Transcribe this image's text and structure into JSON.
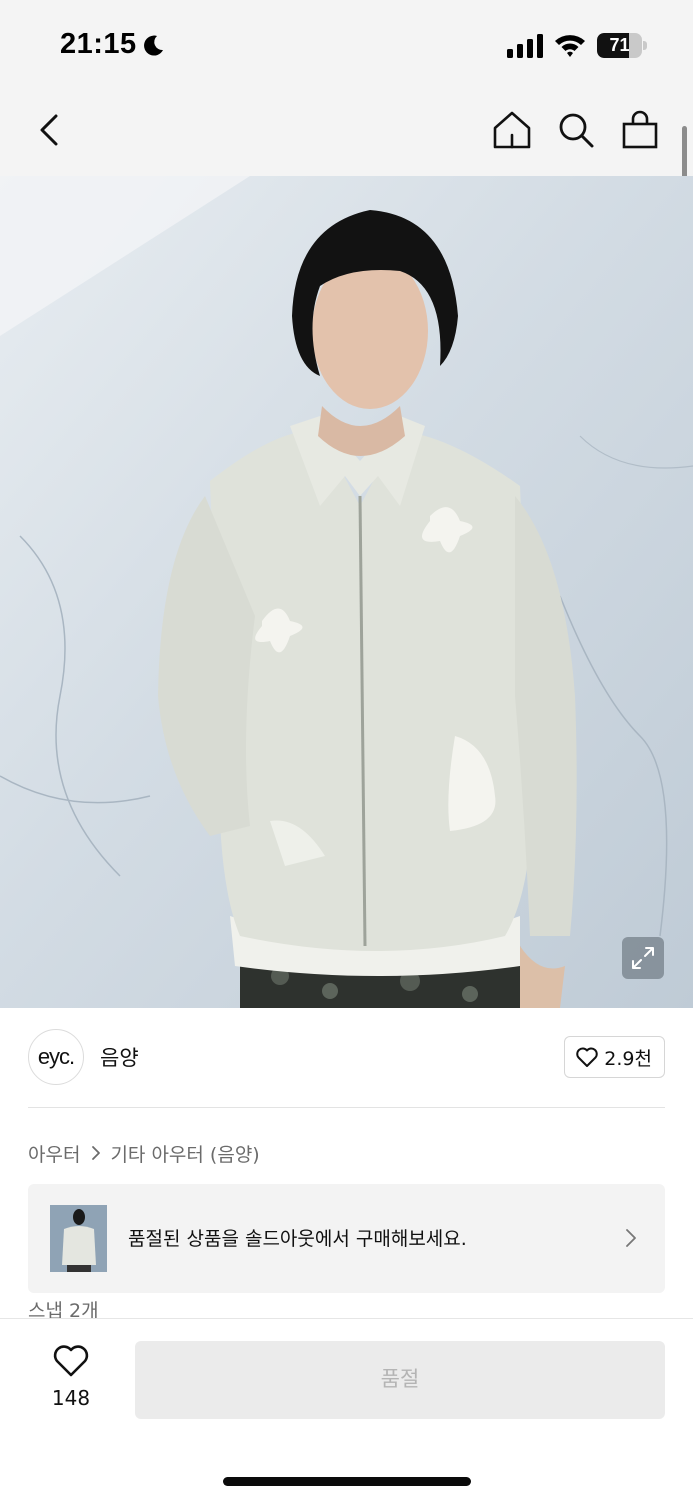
{
  "status_bar": {
    "time": "21:15",
    "battery_level": "71",
    "battery_fraction": 0.71,
    "icons": [
      "moon-icon",
      "signal-icon",
      "wifi-icon",
      "battery-icon"
    ]
  },
  "nav": {
    "icons": [
      "back-icon",
      "home-icon",
      "search-icon",
      "shopping-bag-icon"
    ]
  },
  "product": {
    "brand_logo": "eyc.",
    "brand_name": "음양",
    "like_count": "2.9천",
    "breadcrumb": [
      "아우터",
      "기타 아우터 (음양)"
    ],
    "soldout_banner_text": "품절된 상품을 솔드아웃에서 구매해보세요.",
    "snap_label": "스냅 2개"
  },
  "bottom_bar": {
    "wish_count": "148",
    "buy_button_label": "품절"
  },
  "colors": {
    "background": "#ffffff",
    "header_background": "#f4f4f4",
    "disabled_button": "#ebebeb",
    "disabled_text": "#b4b4b4",
    "muted_text": "#6b6b6b"
  }
}
